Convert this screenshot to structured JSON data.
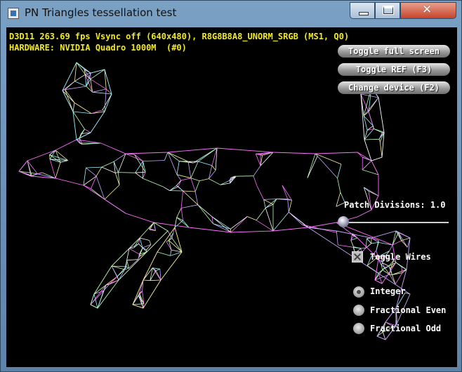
{
  "window": {
    "title": "PN Triangles tessellation test"
  },
  "stats": {
    "line1": "D3D11 263.69 fps Vsync off (640x480), R8G8B8A8_UNORM_SRGB (MS1, Q0)",
    "line2": "HARDWARE: NVIDIA Quadro 1000M  (#0)",
    "text_color": "#f2ea1f"
  },
  "buttons": {
    "toggle_full_screen": "Toggle full screen",
    "toggle_ref": "Toggle REF (F3)",
    "change_device": "Change device (F2)"
  },
  "slider": {
    "label": "Patch Divisions: 1.0",
    "value": 1.0
  },
  "checkbox": {
    "label": "Toggle Wires",
    "checked": true
  },
  "partitioning": {
    "options": [
      "Integer",
      "Fractional Even",
      "Fractional Odd"
    ],
    "selected": "Integer"
  },
  "icons": {
    "app": "app-window-icon",
    "minimize": "minimize-icon",
    "maximize": "maximize-icon",
    "close": "close-icon"
  }
}
